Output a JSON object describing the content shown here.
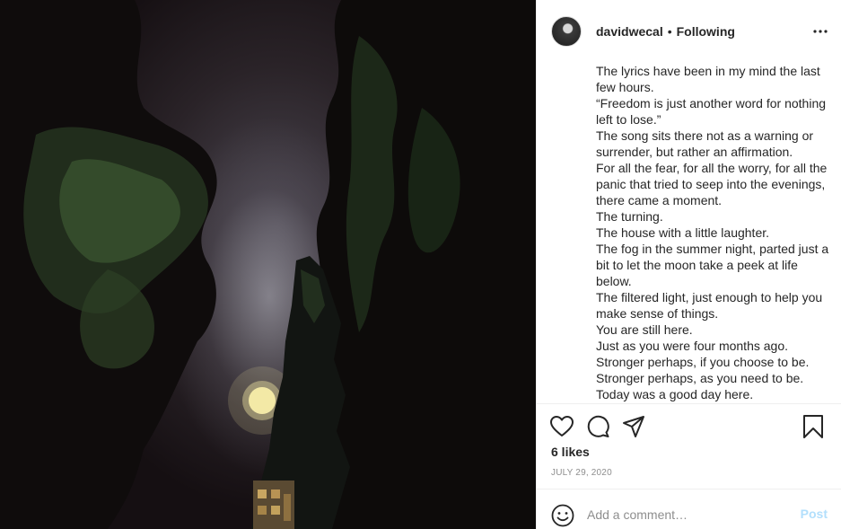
{
  "post": {
    "username": "davidwecal",
    "separator": "•",
    "follow_status": "Following",
    "caption_lines": [
      "The lyrics have been in my mind the last few hours.",
      "“Freedom is just another word for nothing left to lose.”",
      "The song sits there not as a warning or surrender, but rather an affirmation.",
      "For all the fear, for all the worry, for all the panic that tried to seep into the evenings, there came a moment.",
      "The turning.",
      "The house with a little laughter.",
      "The fog in the summer night, parted just a bit to let the moon take a peek at life below.",
      "The filtered light, just enough to help you make sense of things.",
      "You are still here.",
      "Just as you were four months ago.",
      "Stronger perhaps, if you choose to be.",
      "Stronger perhaps, as you need to be.",
      "Today was a good day here."
    ],
    "likes": "6 likes",
    "date": "JULY 29, 2020"
  },
  "comment": {
    "placeholder": "Add a comment…",
    "post_label": "Post"
  },
  "icons": {
    "more": "more-options-icon",
    "like": "heart-icon",
    "comment": "comment-bubble-icon",
    "share": "paper-plane-icon",
    "save": "bookmark-icon",
    "emoji": "smiley-icon"
  },
  "colors": {
    "text": "#262626",
    "muted": "#8e8e8e",
    "post_button_disabled": "#b2dffc",
    "divider": "#efefef"
  }
}
